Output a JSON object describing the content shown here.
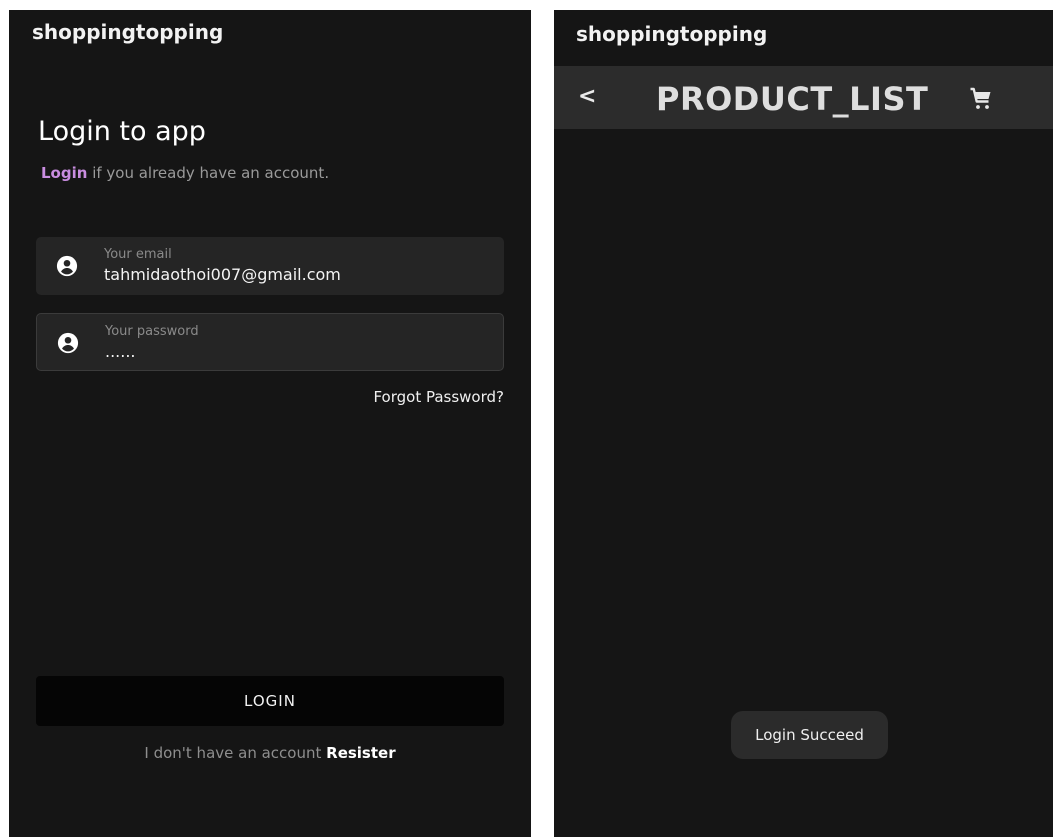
{
  "login_screen": {
    "app_title": "shoppingtopping",
    "heading": "Login to app",
    "subtitle_link": "Login",
    "subtitle_rest": " if you already have an account.",
    "email": {
      "label": "Your email",
      "value": "tahmidaothoi007@gmail.com",
      "icon": "account-circle-icon"
    },
    "password": {
      "label": "Your password",
      "value": "......",
      "icon": "account-circle-icon"
    },
    "forgot_password": "Forgot Password?",
    "login_button": "LOGIN",
    "register_prompt": "I don't have an account ",
    "register_link": "Resister"
  },
  "product_screen": {
    "app_title": "shoppingtopping",
    "back_label": "<",
    "title": "PRODUCT_LIST",
    "cart_icon": "cart-icon",
    "toast": "Login Succeed"
  },
  "colors": {
    "background": "#151515",
    "field": "#252525",
    "link_accent": "#c98de0",
    "button": "#050505",
    "app_bar": "#2c2c2c"
  }
}
